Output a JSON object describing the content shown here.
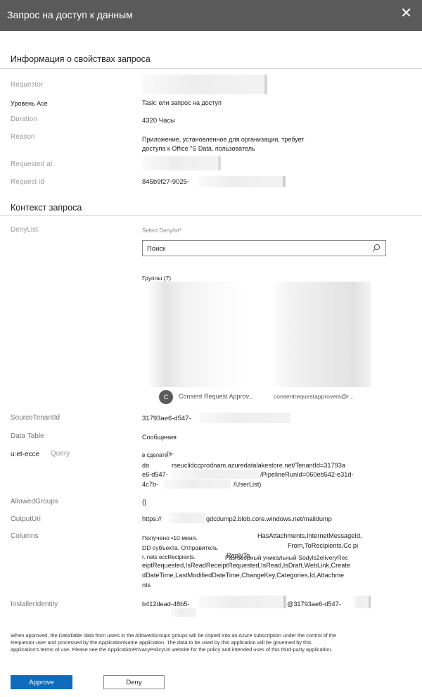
{
  "dialog": {
    "title": "Запрос на доступ к данным",
    "close_glyph": "✕"
  },
  "info_section": {
    "title": "Информация о свойствах запроса"
  },
  "fields": {
    "requestor": {
      "label": "Requestor"
    },
    "level": {
      "label": "Уровень Ace",
      "value": "Task: ели запрос на доступ"
    },
    "duration": {
      "label": "Duration",
      "value": "4320 Часы"
    },
    "reason": {
      "label": "Reason",
      "line1": "Приложение, установленное для организации, требует",
      "line2": "доступа к Office \"S Data. пользователь"
    },
    "requested_at": {
      "label": "Requested at"
    },
    "request_id": {
      "label": "Request id",
      "value": "845b9f27-9025-"
    }
  },
  "context_section": {
    "title": "Контекст запроса"
  },
  "denylist": {
    "label": "DenyList",
    "select_label": "Select Denylist*",
    "search_placeholder": "Поиск",
    "groups_label": "Группы (7)",
    "group_item": {
      "avatar": "C",
      "name": "Consent Request Approv...",
      "email": "consentrequestapprovers@r..."
    }
  },
  "source_tenant": {
    "label": "SourceTenantId",
    "value": "31793ae6-d547-"
  },
  "data_table": {
    "label": "Data Table",
    "value": "Сообщения"
  },
  "query": {
    "label_a": "u:et-ecce",
    "label_b": "Query",
    "l1a": "в сделате",
    "l1b": "(a-",
    "l2a": "do",
    "l2b": "rseuclidccprodnam.azuredatalakestore.net/TenantId=31793a",
    "l3a": "e6-d547-",
    "l3b": "/PipelineRunId=060eb542-e31d-",
    "l4a": "4c7b-",
    "l4b": "/UserList)"
  },
  "allowed_groups": {
    "label": "AllowedGroups",
    "value": "{}"
  },
  "output_uri": {
    "label": "OutputUri",
    "prefix": "https://",
    "suffix": "gdcdump2.blob.core.windows.net/maildump"
  },
  "columns": {
    "label": "Columns",
    "l1a": "Получено •10 меня.",
    "l1b": "HasAttachments,InternetMessageId,",
    "l2a": "DD субъекта. Отправитель",
    "l2b": "From,ToRecipients,Cc pi",
    "l3a": "r. nets eccRecipients.",
    "l3b": "ReplyTo,",
    "l3c": "Разговорный уникальный Sodyls2eliveryRec",
    "l4": "eiptRequested,IsReadReceiptRequested,IsRead,IsDraft,WebLink,Create",
    "l5": "dDateTime,LastModifiedDateTime,ChangeKey,Categories,Id,Attachme",
    "l6": "nts"
  },
  "installer": {
    "label": "InstallerIdentity",
    "value_a": "b412dead-48b5-",
    "value_b": "@31793ae6-d547-"
  },
  "footnote": "When approved, the DataTable data from users in the AllowedGroups groups will be copied into an Azure subscription under the control of the Requestor user and processed by the ApplicationName application. The data to be used by this application will be governed by this application's terms of use. Please see the ApplicationPrivacyPolicyUri website for the policy and intended uses of this third-party application.",
  "actions": {
    "approve": "Approve",
    "deny": "Deny"
  },
  "colors": {
    "titlebar": "#5a5a5a",
    "primary": "#0f6cbd"
  },
  "icons": {
    "close": "close-icon",
    "search": "search-icon"
  }
}
